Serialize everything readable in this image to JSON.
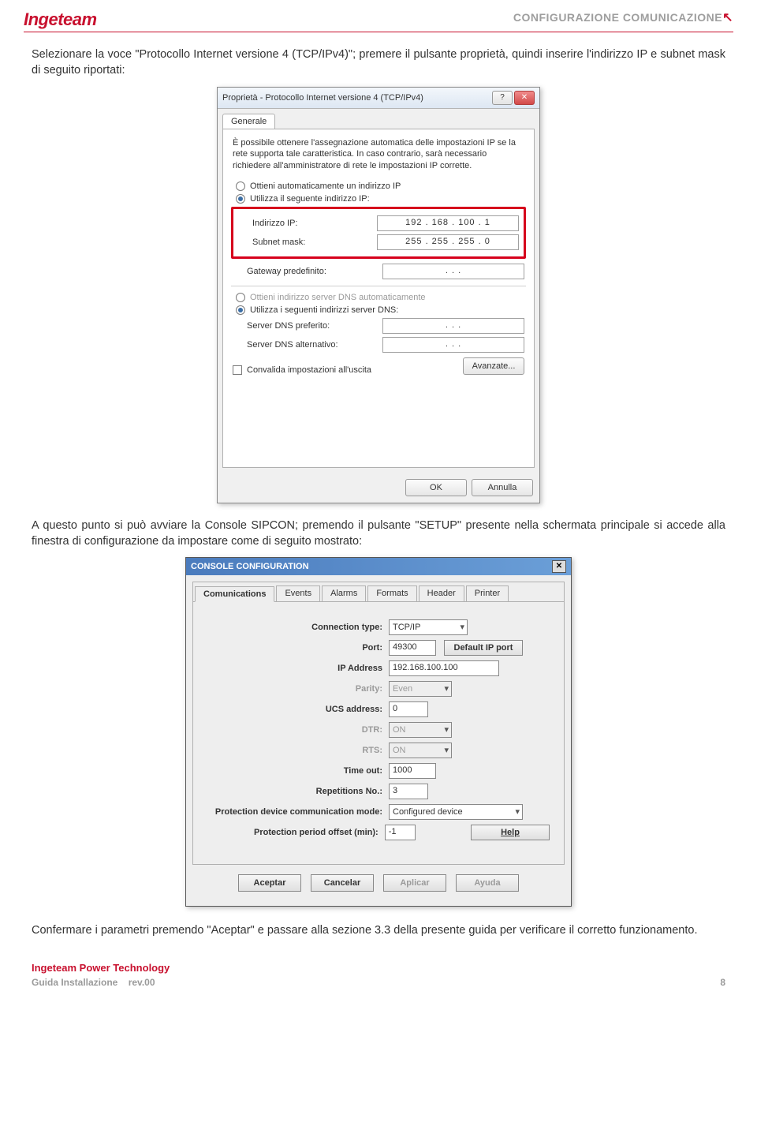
{
  "header": {
    "logo": "Ingeteam",
    "title": "CONFIGURAZIONE COMUNICAZIONE"
  },
  "paragraphs": {
    "p1": "Selezionare la voce \"Protocollo Internet versione 4 (TCP/IPv4)\"; premere il pulsante proprietà, quindi inserire l'indirizzo IP e subnet mask di seguito riportati:",
    "p2": "A questo punto si può avviare la Console SIPCON; premendo il pulsante \"SETUP\" presente nella schermata principale si accede alla finestra di configurazione da impostare come di seguito mostrato:",
    "p3": "Confermare i parametri premendo \"Aceptar\" e passare alla sezione 3.3 della presente guida per verificare il corretto funzionamento."
  },
  "ipdialog": {
    "title": "Proprietà - Protocollo Internet versione 4 (TCP/IPv4)",
    "tab_general": "Generale",
    "description": "È possibile ottenere l'assegnazione automatica delle impostazioni IP se la rete supporta tale caratteristica. In caso contrario, sarà necessario richiedere all'amministratore di rete le impostazioni IP corrette.",
    "radio_auto_ip": "Ottieni automaticamente un indirizzo IP",
    "radio_manual_ip": "Utilizza il seguente indirizzo IP:",
    "label_ip": "Indirizzo IP:",
    "value_ip": "192 . 168 . 100 .  1",
    "label_subnet": "Subnet mask:",
    "value_subnet": "255 . 255 . 255 .  0",
    "label_gateway": "Gateway predefinito:",
    "value_gateway": ".      .      .",
    "radio_auto_dns": "Ottieni indirizzo server DNS automaticamente",
    "radio_manual_dns": "Utilizza i seguenti indirizzi server DNS:",
    "label_dns1": "Server DNS preferito:",
    "value_dns1": ".      .      .",
    "label_dns2": "Server DNS alternativo:",
    "value_dns2": ".      .      .",
    "checkbox_validate": "Convalida impostazioni all'uscita",
    "btn_advanced": "Avanzate...",
    "btn_ok": "OK",
    "btn_cancel": "Annulla"
  },
  "console": {
    "title": "CONSOLE CONFIGURATION",
    "tabs": [
      "Comunications",
      "Events",
      "Alarms",
      "Formats",
      "Header",
      "Printer"
    ],
    "fields": {
      "connection_type": {
        "label": "Connection type:",
        "value": "TCP/IP"
      },
      "port": {
        "label": "Port:",
        "value": "49300"
      },
      "default_ip_port_btn": "Default IP port",
      "ip_address": {
        "label": "IP Address",
        "value": "192.168.100.100"
      },
      "parity": {
        "label": "Parity:",
        "value": "Even"
      },
      "ucs_address": {
        "label": "UCS address:",
        "value": "0"
      },
      "dtr": {
        "label": "DTR:",
        "value": "ON"
      },
      "rts": {
        "label": "RTS:",
        "value": "ON"
      },
      "time_out": {
        "label": "Time out:",
        "value": "1000"
      },
      "repetitions": {
        "label": "Repetitions No.:",
        "value": "3"
      },
      "prot_comm_mode": {
        "label": "Protection device communication mode:",
        "value": "Configured device"
      },
      "prot_offset": {
        "label": "Protection period offset (min):",
        "value": "-1"
      },
      "help_btn": "Help"
    },
    "buttons": {
      "accept": "Aceptar",
      "cancel": "Cancelar",
      "apply": "Aplicar",
      "help": "Ayuda"
    }
  },
  "footer": {
    "company": "Ingeteam Power Technology",
    "doc": "Guida Installazione",
    "rev": "rev.00",
    "page": "8"
  }
}
